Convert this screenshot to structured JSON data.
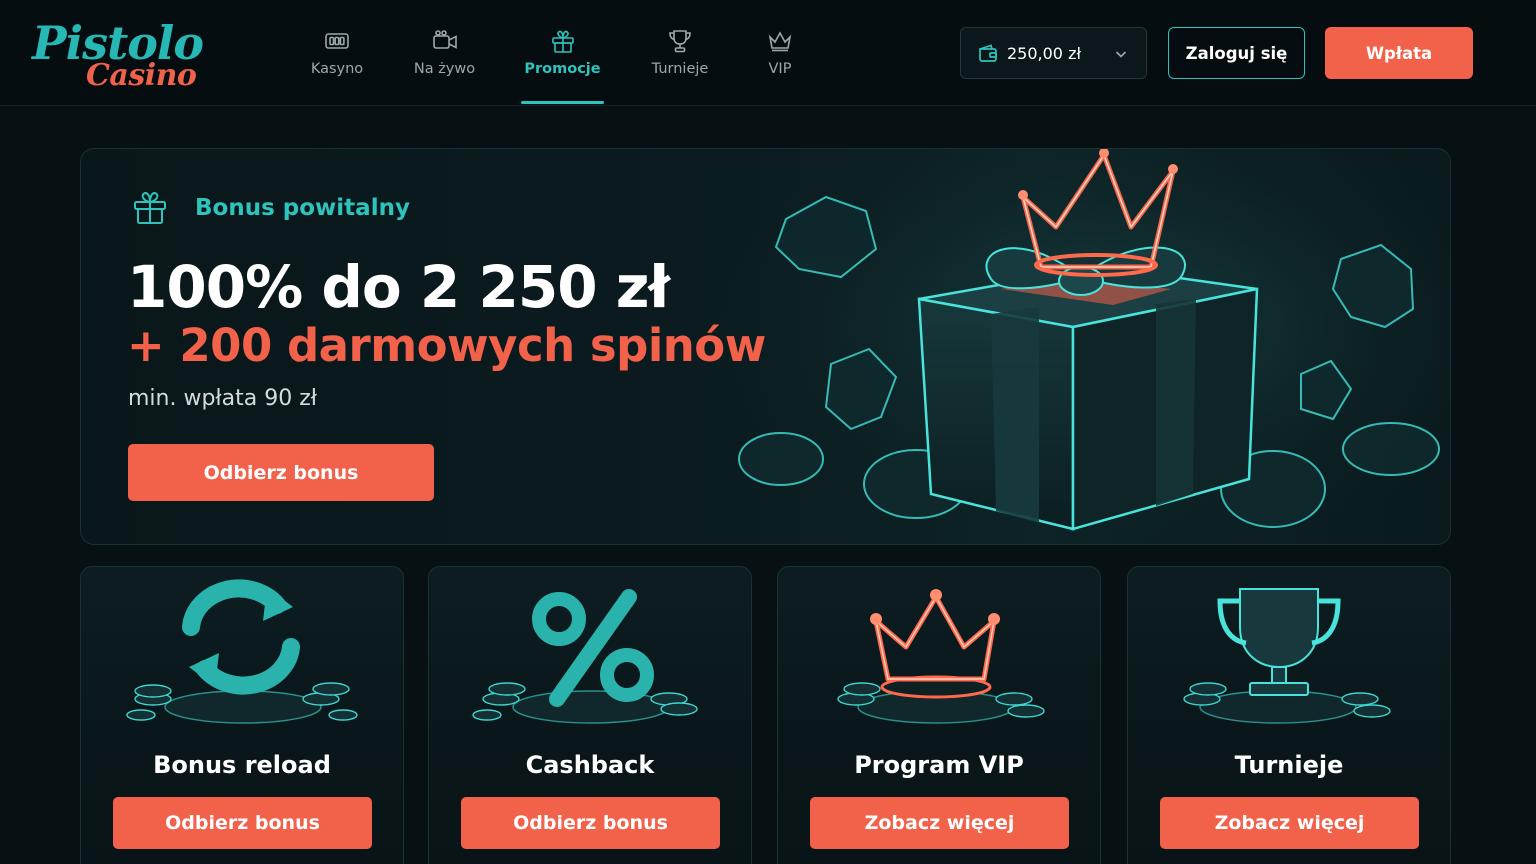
{
  "brand": {
    "logo_top": "Pistolo",
    "logo_bottom": "Casino"
  },
  "nav": {
    "items": [
      {
        "label": "Kasyno",
        "icon": "slot-machine-icon",
        "active": false
      },
      {
        "label": "Na żywo",
        "icon": "live-camera-icon",
        "active": false
      },
      {
        "label": "Promocje",
        "icon": "gift-icon",
        "active": true
      },
      {
        "label": "Turnieje",
        "icon": "trophy-icon",
        "active": false
      },
      {
        "label": "VIP",
        "icon": "crown-icon",
        "active": false
      }
    ]
  },
  "header": {
    "balance": "250,00 zł",
    "login_label": "Zaloguj się",
    "deposit_label": "Wpłata"
  },
  "hero": {
    "tag": "Bonus powitalny",
    "title": "100% do 2 250 zł",
    "subtitle": "+ 200 darmowych spinów",
    "note": "min. wpłata 90 zł",
    "cta": "Odbierz bonus"
  },
  "promos": [
    {
      "title": "Bonus reload",
      "cta": "Odbierz bonus",
      "icon": "reload-arrows-icon"
    },
    {
      "title": "Cashback",
      "cta": "Odbierz bonus",
      "icon": "percent-icon"
    },
    {
      "title": "Program VIP",
      "cta": "Zobacz więcej",
      "icon": "crown-icon"
    },
    {
      "title": "Turnieje",
      "cta": "Zobacz więcej",
      "icon": "trophy-icon"
    }
  ],
  "colors": {
    "accent_teal": "#2ec3bd",
    "accent_orange": "#f2614a",
    "background": "#071114"
  }
}
